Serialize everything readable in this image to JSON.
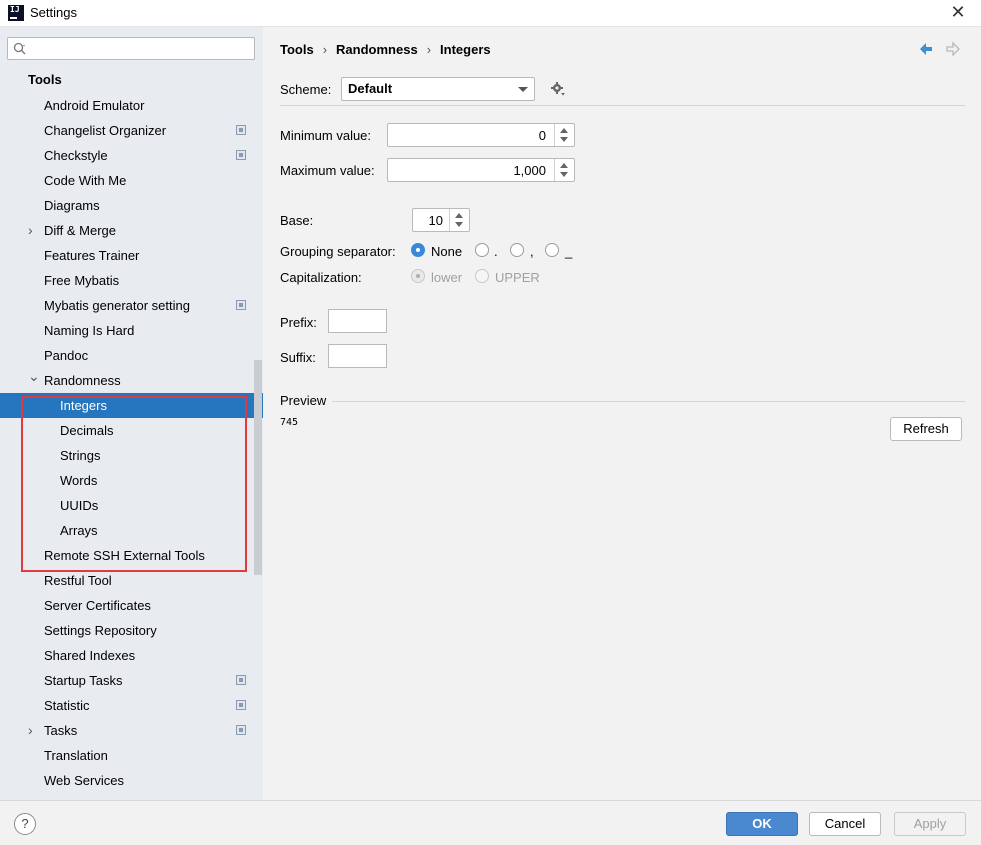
{
  "window": {
    "title": "Settings"
  },
  "sidebar": {
    "search_placeholder": "",
    "group": "Tools",
    "items": [
      {
        "label": "Android Emulator",
        "indent": 1,
        "expand": "",
        "proj": false
      },
      {
        "label": "Changelist Organizer",
        "indent": 1,
        "expand": "",
        "proj": true
      },
      {
        "label": "Checkstyle",
        "indent": 1,
        "expand": "",
        "proj": true
      },
      {
        "label": "Code With Me",
        "indent": 1,
        "expand": "",
        "proj": false
      },
      {
        "label": "Diagrams",
        "indent": 1,
        "expand": "",
        "proj": false
      },
      {
        "label": "Diff & Merge",
        "indent": 1,
        "expand": "›",
        "proj": false
      },
      {
        "label": "Features Trainer",
        "indent": 1,
        "expand": "",
        "proj": false
      },
      {
        "label": "Free Mybatis",
        "indent": 1,
        "expand": "",
        "proj": false
      },
      {
        "label": "Mybatis generator setting",
        "indent": 1,
        "expand": "",
        "proj": true
      },
      {
        "label": "Naming Is Hard",
        "indent": 1,
        "expand": "",
        "proj": false
      },
      {
        "label": "Pandoc",
        "indent": 1,
        "expand": "",
        "proj": false
      },
      {
        "label": "Randomness",
        "indent": 1,
        "expand": "⌄",
        "proj": false
      },
      {
        "label": "Integers",
        "indent": 2,
        "expand": "",
        "proj": false,
        "selected": true
      },
      {
        "label": "Decimals",
        "indent": 2,
        "expand": "",
        "proj": false
      },
      {
        "label": "Strings",
        "indent": 2,
        "expand": "",
        "proj": false
      },
      {
        "label": "Words",
        "indent": 2,
        "expand": "",
        "proj": false
      },
      {
        "label": "UUIDs",
        "indent": 2,
        "expand": "",
        "proj": false
      },
      {
        "label": "Arrays",
        "indent": 2,
        "expand": "",
        "proj": false
      },
      {
        "label": "Remote SSH External Tools",
        "indent": 1,
        "expand": "",
        "proj": false
      },
      {
        "label": "Restful Tool",
        "indent": 1,
        "expand": "",
        "proj": false
      },
      {
        "label": "Server Certificates",
        "indent": 1,
        "expand": "",
        "proj": false
      },
      {
        "label": "Settings Repository",
        "indent": 1,
        "expand": "",
        "proj": false
      },
      {
        "label": "Shared Indexes",
        "indent": 1,
        "expand": "",
        "proj": false
      },
      {
        "label": "Startup Tasks",
        "indent": 1,
        "expand": "",
        "proj": true
      },
      {
        "label": "Statistic",
        "indent": 1,
        "expand": "",
        "proj": true
      },
      {
        "label": "Tasks",
        "indent": 1,
        "expand": "›",
        "proj": true
      },
      {
        "label": "Translation",
        "indent": 1,
        "expand": "",
        "proj": false
      },
      {
        "label": "Web Services",
        "indent": 1,
        "expand": "",
        "proj": false
      }
    ]
  },
  "content": {
    "breadcrumb": [
      "Tools",
      "Randomness",
      "Integers"
    ],
    "scheme_label": "Scheme:",
    "scheme_value": "Default",
    "min_label": "Minimum value:",
    "min_value": "0",
    "max_label": "Maximum value:",
    "max_value": "1,000",
    "base_label": "Base:",
    "base_value": "10",
    "grouping_label": "Grouping separator:",
    "grouping_options": [
      "None",
      ".",
      ",",
      "_"
    ],
    "grouping_selected": "None",
    "cap_label": "Capitalization:",
    "cap_options": [
      "lower",
      "UPPER"
    ],
    "cap_selected": "lower",
    "prefix_label": "Prefix:",
    "suffix_label": "Suffix:",
    "preview_label": "Preview",
    "preview_value": "745",
    "refresh_label": "Refresh"
  },
  "footer": {
    "help": "?",
    "ok": "OK",
    "cancel": "Cancel",
    "apply": "Apply"
  },
  "colors": {
    "selection": "#2675bf",
    "highlight_box": "#e0393e",
    "ok_button": "#4a88cf",
    "sidebar_bg": "#e8ecf1"
  }
}
